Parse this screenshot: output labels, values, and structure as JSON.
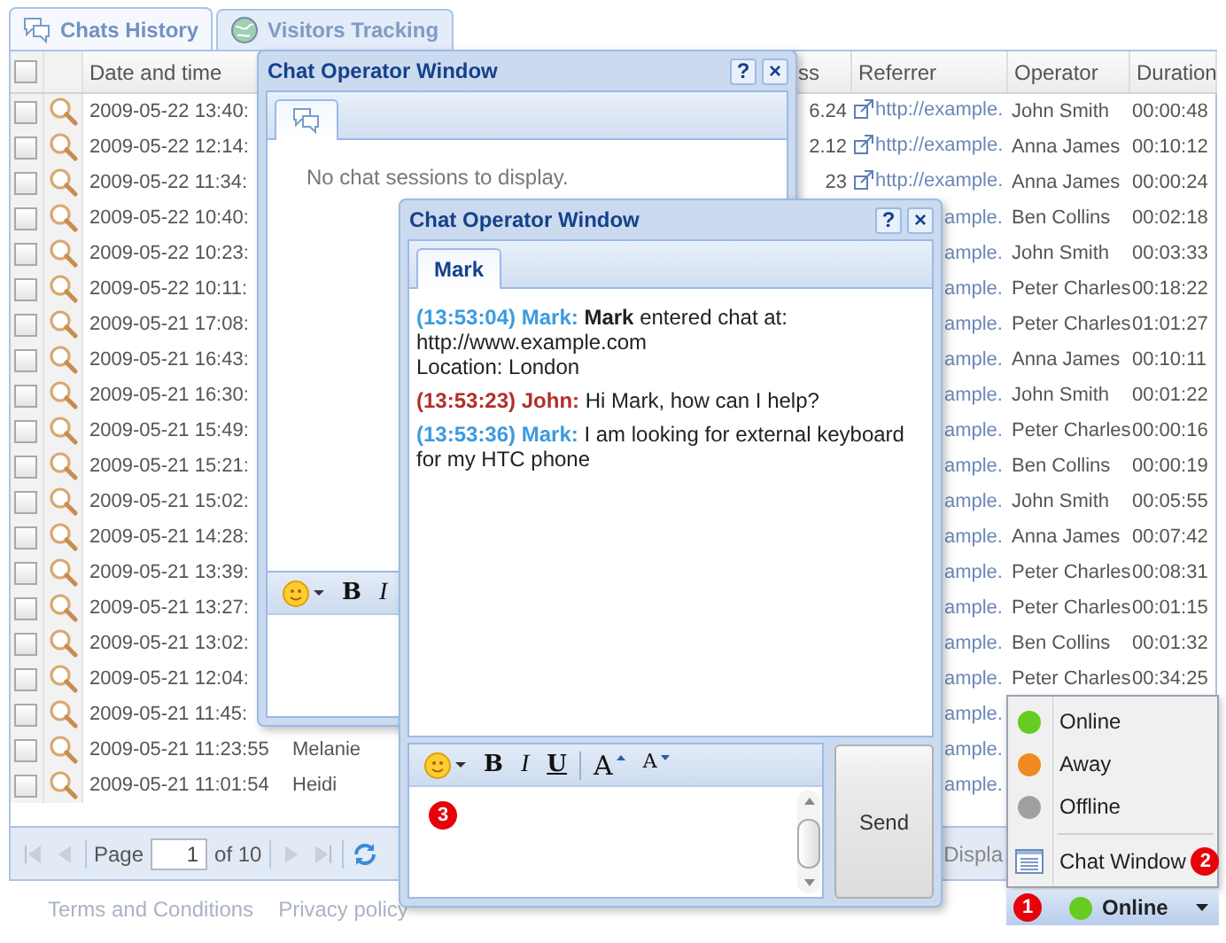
{
  "main_tabs": [
    {
      "label": "Chats History",
      "selected": true
    },
    {
      "label": "Visitors Tracking",
      "selected": false
    }
  ],
  "grid": {
    "header": {
      "date": "Date and time",
      "column_4": "ss",
      "referrer": "Referrer",
      "operator": "Operator",
      "duration": "Duration"
    },
    "header_checked": false,
    "rows": [
      {
        "checked": false,
        "date": "2009-05-22 13:40:",
        "column_4": "6.24",
        "referrer": "http://example.",
        "referrer_icon": true,
        "operator": "John Smith",
        "duration": "00:00:48"
      },
      {
        "checked": false,
        "date": "2009-05-22 12:14:",
        "column_4": "2.12",
        "referrer": "http://example.",
        "referrer_icon": true,
        "operator": "Anna James",
        "duration": "00:10:12"
      },
      {
        "checked": false,
        "date": "2009-05-22 11:34:",
        "column_4": "23",
        "referrer": "http://example.",
        "referrer_icon": true,
        "operator": "Anna James",
        "duration": "00:00:24"
      },
      {
        "checked": false,
        "date": "2009-05-22 10:40:",
        "referrer": "ample.",
        "referrer_icon": false,
        "operator": "Ben Collins",
        "duration": "00:02:18"
      },
      {
        "checked": false,
        "date": "2009-05-22 10:23:",
        "referrer": "ample.",
        "referrer_icon": false,
        "operator": "John Smith",
        "duration": "00:03:33"
      },
      {
        "checked": false,
        "date": "2009-05-22 10:11:",
        "referrer": "ample.",
        "referrer_icon": false,
        "operator": "Peter Charles",
        "duration": "00:18:22"
      },
      {
        "checked": false,
        "date": "2009-05-21 17:08:",
        "referrer": "ample.",
        "referrer_icon": false,
        "operator": "Peter Charles",
        "duration": "01:01:27"
      },
      {
        "checked": false,
        "date": "2009-05-21 16:43:",
        "referrer": "ample.",
        "referrer_icon": false,
        "operator": "Anna James",
        "duration": "00:10:11"
      },
      {
        "checked": false,
        "date": "2009-05-21 16:30:",
        "referrer": "ample.",
        "referrer_icon": false,
        "operator": "John Smith",
        "duration": "00:01:22"
      },
      {
        "checked": false,
        "date": "2009-05-21 15:49:",
        "referrer": "ample.",
        "referrer_icon": false,
        "operator": "Peter Charles",
        "duration": "00:00:16"
      },
      {
        "checked": false,
        "date": "2009-05-21 15:21:",
        "referrer": "ample.",
        "referrer_icon": false,
        "operator": "Ben Collins",
        "duration": "00:00:19"
      },
      {
        "checked": false,
        "date": "2009-05-21 15:02:",
        "referrer": "ample.",
        "referrer_icon": false,
        "operator": "John Smith",
        "duration": "00:05:55"
      },
      {
        "checked": false,
        "date": "2009-05-21 14:28:",
        "referrer": "ample.",
        "referrer_icon": false,
        "operator": "Anna James",
        "duration": "00:07:42"
      },
      {
        "checked": false,
        "date": "2009-05-21 13:39:",
        "referrer": "ample.",
        "referrer_icon": false,
        "operator": "Peter Charles",
        "duration": "00:08:31"
      },
      {
        "checked": false,
        "date": "2009-05-21 13:27:",
        "referrer": "ample.",
        "referrer_icon": false,
        "operator": "Peter Charles",
        "duration": "00:01:15"
      },
      {
        "checked": false,
        "date": "2009-05-21 13:02:",
        "referrer": "ample.",
        "referrer_icon": false,
        "operator": "Ben Collins",
        "duration": "00:01:32"
      },
      {
        "checked": false,
        "date": "2009-05-21 12:04:",
        "referrer": "ample.",
        "referrer_icon": false,
        "operator": "Peter Charles",
        "duration": "00:34:25"
      },
      {
        "checked": false,
        "date": "2009-05-21 11:45:",
        "referrer": "ample.",
        "referrer_icon": false
      },
      {
        "checked": false,
        "date": "2009-05-21 11:23:55",
        "column_3": "Melanie",
        "referrer": "ample.",
        "referrer_icon": false
      },
      {
        "checked": false,
        "date": "2009-05-21 11:01:54",
        "column_3": "Heidi",
        "referrer": "ample.",
        "referrer_icon": false
      }
    ],
    "pager": {
      "page_label": "Page",
      "page": "1",
      "of": "of 10",
      "display": "Displa"
    }
  },
  "footer_links": [
    "Terms and Conditions",
    "Privacy policy"
  ],
  "windows": [
    {
      "title": "Chat Operator Window",
      "title_buttons": [
        "?",
        "×"
      ],
      "tabs": [
        {
          "selected": true
        }
      ],
      "empty_text": "No chat sessions to display.",
      "toolbar": [
        {
          "kind": "emoticons"
        },
        {
          "kind": "bold",
          "label": "B"
        },
        {
          "kind": "italic",
          "label": "I"
        }
      ]
    },
    {
      "title": "Chat Operator Window",
      "title_buttons": [
        "?",
        "×"
      ],
      "tabs": [
        {
          "label": "Mark",
          "selected": true
        }
      ],
      "messages": [
        {
          "sender": "(13:53:04) Mark:",
          "kind": "visitor",
          "lines": [
            "**Mark** entered chat at:",
            "http://www.example.com",
            "Location: London"
          ]
        },
        {
          "sender": "(13:53:23) John:",
          "kind": "operator",
          "lines": [
            "Hi Mark, how can I help?"
          ]
        },
        {
          "sender": "(13:53:36) Mark:",
          "kind": "visitor",
          "lines": [
            "I am looking for external keyboard for my HTC phone"
          ]
        }
      ],
      "toolbar": [
        {
          "kind": "emoticons"
        },
        {
          "kind": "bold",
          "label": "B"
        },
        {
          "kind": "italic",
          "label": "I"
        },
        {
          "kind": "underline",
          "label": "U"
        },
        {
          "kind": "grow",
          "label": "A"
        },
        {
          "kind": "shrink",
          "label": "A"
        }
      ],
      "badge": "3",
      "send": "Send"
    }
  ],
  "status_menu": {
    "items": [
      {
        "kind": "status",
        "label": "Online",
        "color": "#66cc22"
      },
      {
        "kind": "status",
        "label": "Away",
        "color": "#f08a20"
      },
      {
        "kind": "status",
        "label": "Offline",
        "color": "#a0a0a0"
      },
      {
        "kind": "window",
        "label": "Chat Window",
        "badge": "2"
      }
    ]
  },
  "status_button": {
    "label": "Online",
    "color": "#66cc22",
    "badge": "1"
  }
}
